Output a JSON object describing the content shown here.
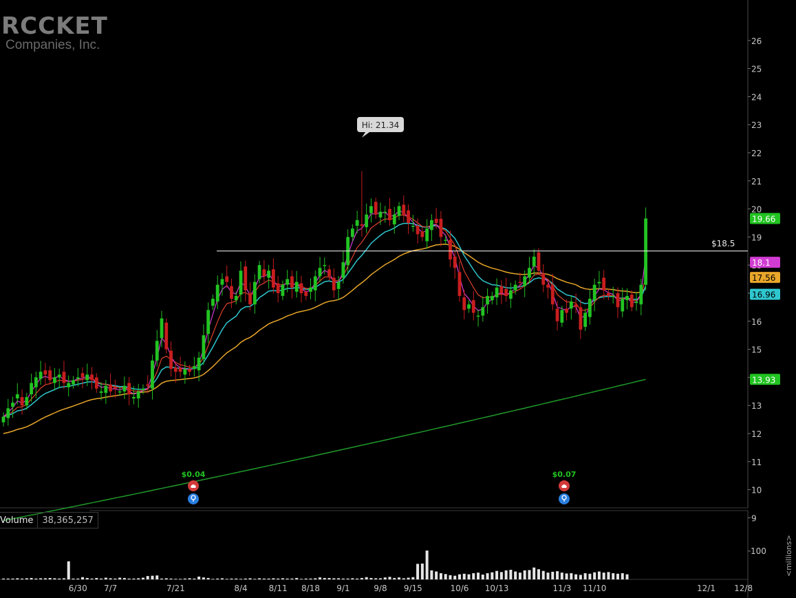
{
  "logo": {
    "main": "RCCKET",
    "sub": "Companies, Inc."
  },
  "volume_panel": {
    "label": "Volume",
    "value": "38,365,257",
    "unit_label": "<millions>",
    "tick": "100"
  },
  "colors": {
    "up": "#22c322",
    "down": "#c81e1e",
    "ma_magenta": "#d23cd2",
    "ma_red": "#e0412d",
    "ma_cyan": "#2fc7cf",
    "ma_orange": "#e8a62a",
    "ma_green": "#1f9a2a",
    "grid_line": "#ffffff",
    "volume": "#e6e6e6"
  },
  "chart_data": {
    "type": "candlestick",
    "y_ticks": [
      9,
      10,
      11,
      12,
      13,
      14,
      15,
      16,
      17,
      18,
      19,
      20,
      21,
      22,
      23,
      24,
      25,
      26
    ],
    "ylim": [
      8.5,
      26.3
    ],
    "x_labels": [
      "6/30",
      "7/7",
      "7/21",
      "8/4",
      "8/11",
      "8/18",
      "9/1",
      "9/8",
      "9/15",
      "10/6",
      "10/13",
      "11/3",
      "11/10",
      "12/1",
      "12/8"
    ],
    "x_label_bar_index": [
      16,
      23,
      37,
      51,
      59,
      66,
      73,
      81,
      88,
      98,
      106,
      120,
      127,
      151,
      159
    ],
    "bar_count": 139,
    "closes": [
      12.6,
      12.9,
      13.1,
      13.4,
      13.0,
      13.3,
      13.8,
      14.0,
      14.2,
      14.1,
      13.9,
      14.0,
      14.1,
      13.8,
      13.8,
      13.9,
      14.0,
      14.0,
      14.1,
      13.9,
      13.6,
      13.5,
      13.7,
      13.5,
      13.6,
      13.5,
      13.7,
      13.4,
      13.3,
      13.5,
      13.6,
      13.7,
      14.6,
      15.3,
      16.1,
      15.0,
      14.3,
      14.2,
      14.2,
      14.3,
      14.2,
      14.4,
      14.7,
      15.5,
      16.4,
      16.8,
      17.3,
      17.5,
      17.4,
      16.8,
      16.9,
      17.8,
      17.1,
      16.6,
      17.4,
      18.0,
      17.6,
      17.8,
      17.2,
      17.0,
      17.3,
      17.5,
      17.2,
      17.4,
      17.0,
      16.9,
      17.2,
      17.6,
      17.9,
      18.0,
      17.6,
      17.1,
      17.4,
      18.1,
      19.0,
      19.3,
      19.6,
      19.4,
      19.8,
      20.1,
      19.8,
      19.9,
      19.9,
      19.6,
      19.8,
      20.1,
      19.8,
      19.5,
      19.4,
      19.1,
      19.0,
      19.3,
      19.6,
      19.5,
      19.0,
      18.9,
      18.2,
      17.9,
      16.9,
      16.4,
      16.6,
      16.3,
      16.2,
      16.5,
      16.9,
      16.9,
      17.2,
      17.0,
      16.9,
      17.1,
      17.3,
      17.4,
      17.6,
      17.9,
      18.3,
      17.8,
      17.3,
      17.2,
      16.6,
      16.0,
      16.4,
      16.3,
      16.7,
      16.5,
      15.7,
      16.3,
      16.8,
      17.3,
      17.4,
      17.1,
      16.9,
      16.9,
      16.5,
      16.8,
      16.9,
      16.5,
      16.7,
      17.3,
      19.66
    ],
    "high": 21.34,
    "last_close": 19.66,
    "ma_labels": {
      "magenta": 18.1,
      "orange": 17.56,
      "cyan": 16.96,
      "green": 13.93
    },
    "ma_green_values": [
      8.9,
      13.93
    ],
    "ma_orange_values": [
      11.3,
      17.56
    ],
    "hlines": [
      {
        "value": 18.5,
        "label": "$18.5"
      }
    ],
    "annotations": {
      "high_label": "Hi: 21.34",
      "earnings": [
        {
          "label": "$0.04",
          "bar_index": 38
        },
        {
          "label": "$0.07",
          "bar_index": 115
        }
      ]
    },
    "volume_tick": 100,
    "volume_ylim": [
      0,
      180
    ],
    "volume_values": [
      3,
      3,
      3,
      4,
      3,
      4,
      5,
      3,
      4,
      4,
      5,
      4,
      3,
      4,
      64,
      3,
      3,
      8,
      5,
      3,
      5,
      3,
      6,
      4,
      3,
      6,
      5,
      3,
      3,
      4,
      6,
      12,
      13,
      14,
      3,
      4,
      3,
      2,
      2,
      3,
      4,
      3,
      10,
      7,
      5,
      2,
      3,
      4,
      2,
      3,
      3,
      2,
      3,
      4,
      2,
      4,
      3,
      3,
      4,
      3,
      4,
      3,
      3,
      5,
      2,
      3,
      3,
      4,
      7,
      5,
      5,
      4,
      4,
      3,
      3,
      4,
      3,
      5,
      8,
      5,
      4,
      4,
      7,
      9,
      5,
      7,
      4,
      6,
      8,
      55,
      56,
      102,
      32,
      28,
      22,
      19,
      15,
      13,
      18,
      20,
      18,
      22,
      24,
      17,
      22,
      25,
      30,
      26,
      32,
      34,
      28,
      24,
      32,
      33,
      42,
      36,
      30,
      24,
      27,
      29,
      24,
      21,
      22,
      18,
      16,
      22,
      20,
      25,
      28,
      24,
      26,
      22,
      20,
      22,
      18
    ]
  }
}
